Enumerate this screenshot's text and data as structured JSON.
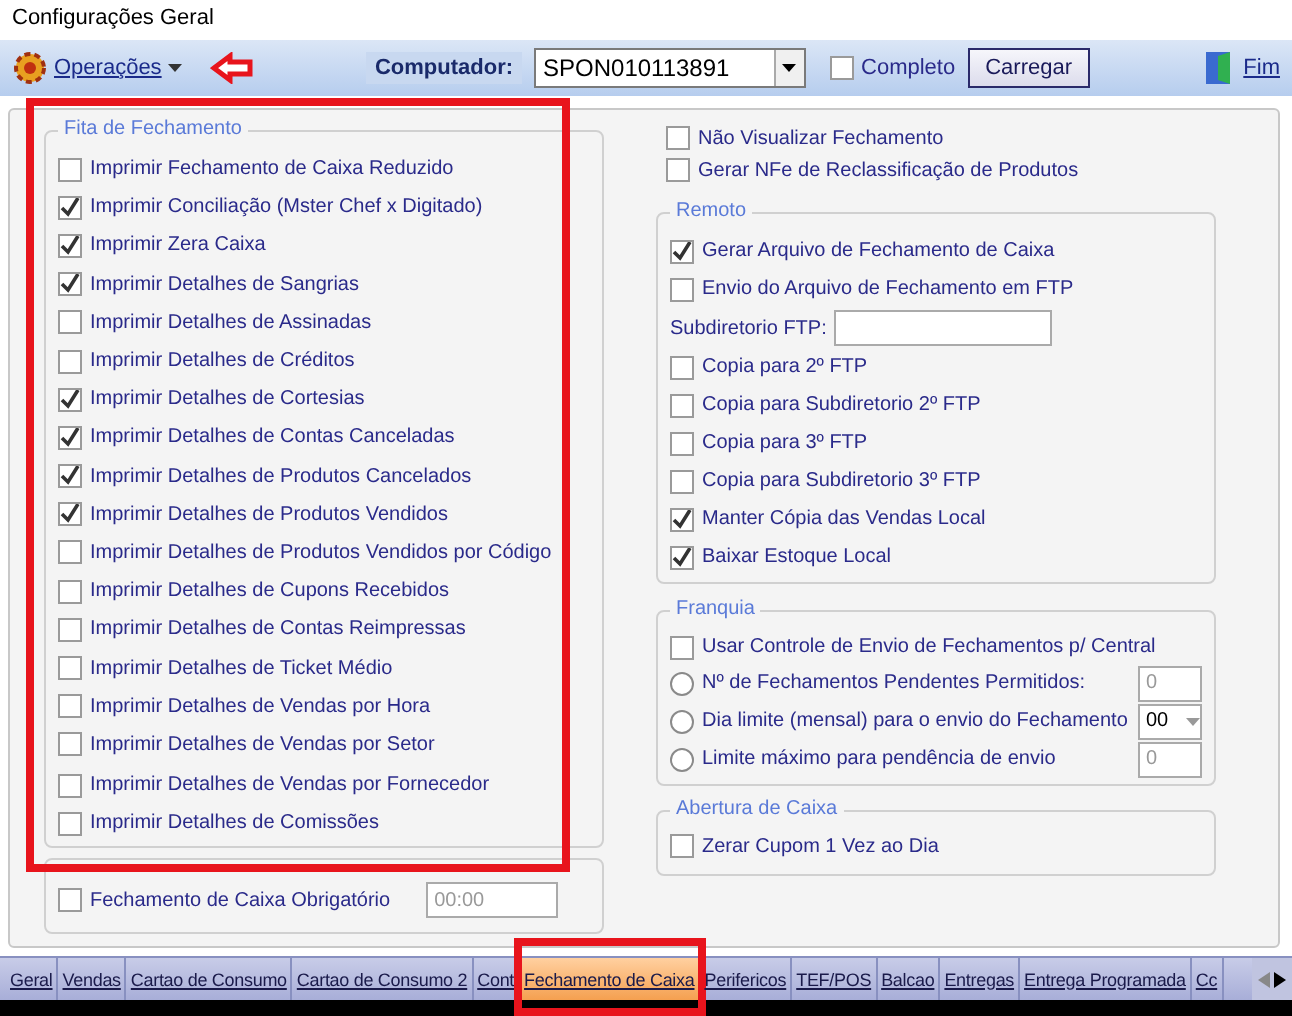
{
  "window": {
    "title": "Configurações Geral"
  },
  "toolbar": {
    "operations": "Operações",
    "pointer_arrow": true,
    "computer_label": "Computador:",
    "computer_value": "SPON010113891",
    "complete": {
      "label": "Completo",
      "checked": false
    },
    "load_button": "Carregar",
    "exit_button": "Fim"
  },
  "fita": {
    "title": "Fita de Fechamento",
    "highlighted": true,
    "items": [
      {
        "label": "Imprimir Fechamento de Caixa Reduzido",
        "checked": false
      },
      {
        "label": "Imprimir Conciliação (Mster Chef x Digitado)",
        "checked": true
      },
      {
        "label": "Imprimir Zera Caixa",
        "checked": true
      },
      {
        "label": "Imprimir Detalhes de Sangrias",
        "checked": true
      },
      {
        "label": "Imprimir Detalhes de Assinadas",
        "checked": false
      },
      {
        "label": "Imprimir Detalhes de Créditos",
        "checked": false
      },
      {
        "label": "Imprimir Detalhes de Cortesias",
        "checked": true
      },
      {
        "label": "Imprimir Detalhes de Contas Canceladas",
        "checked": true
      },
      {
        "label": "Imprimir Detalhes de Produtos Cancelados",
        "checked": true
      },
      {
        "label": "Imprimir Detalhes de Produtos Vendidos",
        "checked": true
      },
      {
        "label": "Imprimir Detalhes de Produtos Vendidos por Código",
        "checked": false
      },
      {
        "label": "Imprimir Detalhes de Cupons Recebidos",
        "checked": false
      },
      {
        "label": "Imprimir Detalhes de Contas Reimpressas",
        "checked": false
      },
      {
        "label": "Imprimir Detalhes de Ticket Médio",
        "checked": false
      },
      {
        "label": "Imprimir Detalhes de Vendas por Hora",
        "checked": false
      },
      {
        "label": "Imprimir Detalhes de Vendas por Setor",
        "checked": false
      },
      {
        "label": "Imprimir Detalhes de Vendas por Fornecedor",
        "checked": false
      },
      {
        "label": "Imprimir Detalhes de Comissões",
        "checked": false
      }
    ]
  },
  "obrigatorio": {
    "label": "Fechamento de Caixa Obrigatório",
    "checked": false,
    "time": "00:00"
  },
  "top_options": [
    {
      "label": "Não Visualizar Fechamento",
      "checked": false
    },
    {
      "label": "Gerar NFe de Reclassificação de Produtos",
      "checked": false
    }
  ],
  "remoto": {
    "title": "Remoto",
    "items": [
      {
        "kind": "check",
        "label": "Gerar Arquivo de Fechamento de Caixa",
        "checked": true
      },
      {
        "kind": "check",
        "label": "Envio do Arquivo de Fechamento em FTP",
        "checked": false
      },
      {
        "kind": "field",
        "label": "Subdiretorio FTP:"
      },
      {
        "kind": "check",
        "label": "Copia para 2º FTP",
        "checked": false
      },
      {
        "kind": "check",
        "label": "Copia para Subdiretorio 2º FTP",
        "checked": false
      },
      {
        "kind": "check",
        "label": "Copia para 3º FTP",
        "checked": false
      },
      {
        "kind": "check",
        "label": "Copia para Subdiretorio 3º FTP",
        "checked": false
      },
      {
        "kind": "check",
        "label": "Manter Cópia das Vendas Local",
        "checked": true
      },
      {
        "kind": "check",
        "label": "Baixar Estoque Local",
        "checked": true
      }
    ]
  },
  "franquia": {
    "title": "Franquia",
    "items": [
      {
        "kind": "check",
        "label": "Usar Controle de Envio de Fechamentos p/ Central",
        "checked": false
      },
      {
        "kind": "radio",
        "label": "Nº de Fechamentos Pendentes Permitidos:",
        "selected": false,
        "field": {
          "kind": "input",
          "placeholder": "0"
        }
      },
      {
        "kind": "radio",
        "label": "Dia limite (mensal) para o envio do Fechamento",
        "selected": false,
        "field": {
          "kind": "select",
          "value": "00"
        }
      },
      {
        "kind": "radio",
        "label": "Limite máximo para pendência de envio",
        "selected": false,
        "field": {
          "kind": "input",
          "placeholder": "0"
        }
      }
    ]
  },
  "abertura": {
    "title": "Abertura de Caixa",
    "items": [
      {
        "label": "Zerar Cupom 1 Vez ao Dia",
        "checked": false
      }
    ]
  },
  "tabs": [
    {
      "label": "Geral",
      "selected": false
    },
    {
      "label": "Vendas",
      "selected": false
    },
    {
      "label": "Cartao de Consumo",
      "selected": false
    },
    {
      "label": "Cartao de Consumo 2",
      "selected": false
    },
    {
      "label": "Cont",
      "selected": false
    },
    {
      "label": "Fechamento de Caixa",
      "selected": true,
      "highlighted": true
    },
    {
      "label": "Perifericos",
      "selected": false
    },
    {
      "label": "TEF/POS",
      "selected": false
    },
    {
      "label": "Balcao",
      "selected": false
    },
    {
      "label": "Entregas",
      "selected": false
    },
    {
      "label": "Entrega Programada",
      "selected": false
    },
    {
      "label": "Cc",
      "selected": false
    }
  ]
}
